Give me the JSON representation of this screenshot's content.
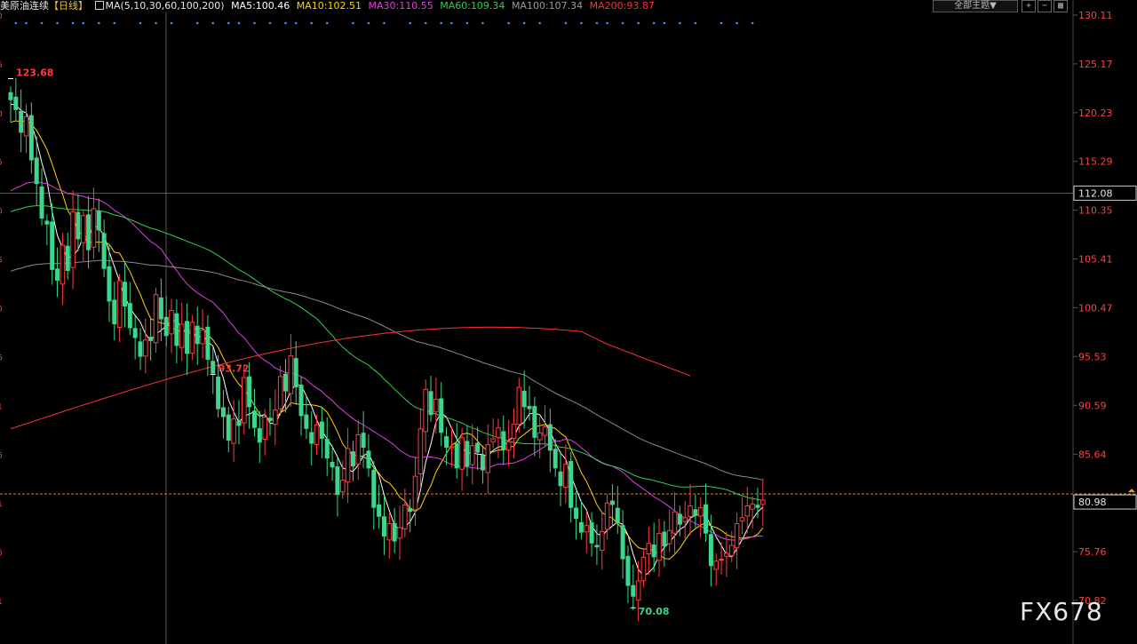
{
  "header": {
    "symbol": "美原油连续",
    "period": "【日线】",
    "ma_label": "MA(5,10,30,60,100,200)",
    "ma5": "MA5:100.46",
    "ma10": "MA10:102.51",
    "ma30": "MA30:110.55",
    "ma60": "MA60:109.34",
    "ma100": "MA100:107.34",
    "ma200": "MA200:93.87",
    "theme_button": "全部主题▼"
  },
  "colors": {
    "up": "#ff3c3c",
    "down": "#3cd68c",
    "ma5": "#ffffff",
    "ma10": "#ffd400",
    "ma30": "#e040e0",
    "ma60": "#30d050",
    "ma100": "#8a8a8a",
    "ma200": "#ff3030",
    "axis_label": "#ff4040",
    "grid": "#262626"
  },
  "watermark": "FX678",
  "chart_data": {
    "type": "candlestick",
    "yticks": [
      130.11,
      125.17,
      120.23,
      115.29,
      110.35,
      105.41,
      100.47,
      95.53,
      90.59,
      85.64,
      80.7,
      75.76,
      70.82
    ],
    "ylim": [
      69.0,
      130.11
    ],
    "crosshair_value": "112.08",
    "current_price": "80.98",
    "annotations": [
      {
        "text": "123.68",
        "value": 123.68
      },
      {
        "text": "93.72",
        "value": 93.72
      },
      {
        "text": "70.08",
        "value": 70.08
      }
    ],
    "closes": [
      121.5,
      120.5,
      118.2,
      119.8,
      115.4,
      113.0,
      109.5,
      108.9,
      104.3,
      103.2,
      106.8,
      104.2,
      110.2,
      107.4,
      109.8,
      106.3,
      110.5,
      108.3,
      104.4,
      101.1,
      98.8,
      103.2,
      100.6,
      98.4,
      97.4,
      95.5,
      97.2,
      97.1,
      101.8,
      99.3,
      97.6,
      100.2,
      96.6,
      98.8,
      95.8,
      99.0,
      96.8,
      98.2,
      95.2,
      93.8,
      90.2,
      89.4,
      87.0,
      89.2,
      88.5,
      93.4,
      90.4,
      88.3,
      86.8,
      89.4,
      89.0,
      90.1,
      93.5,
      92.0,
      95.6,
      92.4,
      89.5,
      88.2,
      86.7,
      88.6,
      87.2,
      85.2,
      84.3,
      81.5,
      83.0,
      86.2,
      84.4,
      87.6,
      86.3,
      84.2,
      80.2,
      79.3,
      77.3,
      78.6,
      76.8,
      78.2,
      80.5,
      79.8,
      83.4,
      88.2,
      92.2,
      89.6,
      91.2,
      87.8,
      86.3,
      86.4,
      84.2,
      87.3,
      84.4,
      86.5,
      85.8,
      84.0,
      86.6,
      87.2,
      88.3,
      86.1,
      86.9,
      88.7,
      92.4,
      90.4,
      90.2,
      87.3,
      87.8,
      88.4,
      86.0,
      84.2,
      82.4,
      84.6,
      80.2,
      79.1,
      77.7,
      78.4,
      76.6,
      76.2,
      77.8,
      80.7,
      80.5,
      78.6,
      75.0,
      72.3,
      71.2,
      72.8,
      75.2,
      76.6,
      75.2,
      77.6,
      76.3,
      77.9,
      79.8,
      78.5,
      79.2,
      80.4,
      79.4,
      80.2,
      77.6,
      74.3,
      74.8,
      75.0,
      75.6,
      76.4,
      78.6,
      79.2,
      80.4,
      80.6,
      80.2,
      80.98
    ]
  }
}
